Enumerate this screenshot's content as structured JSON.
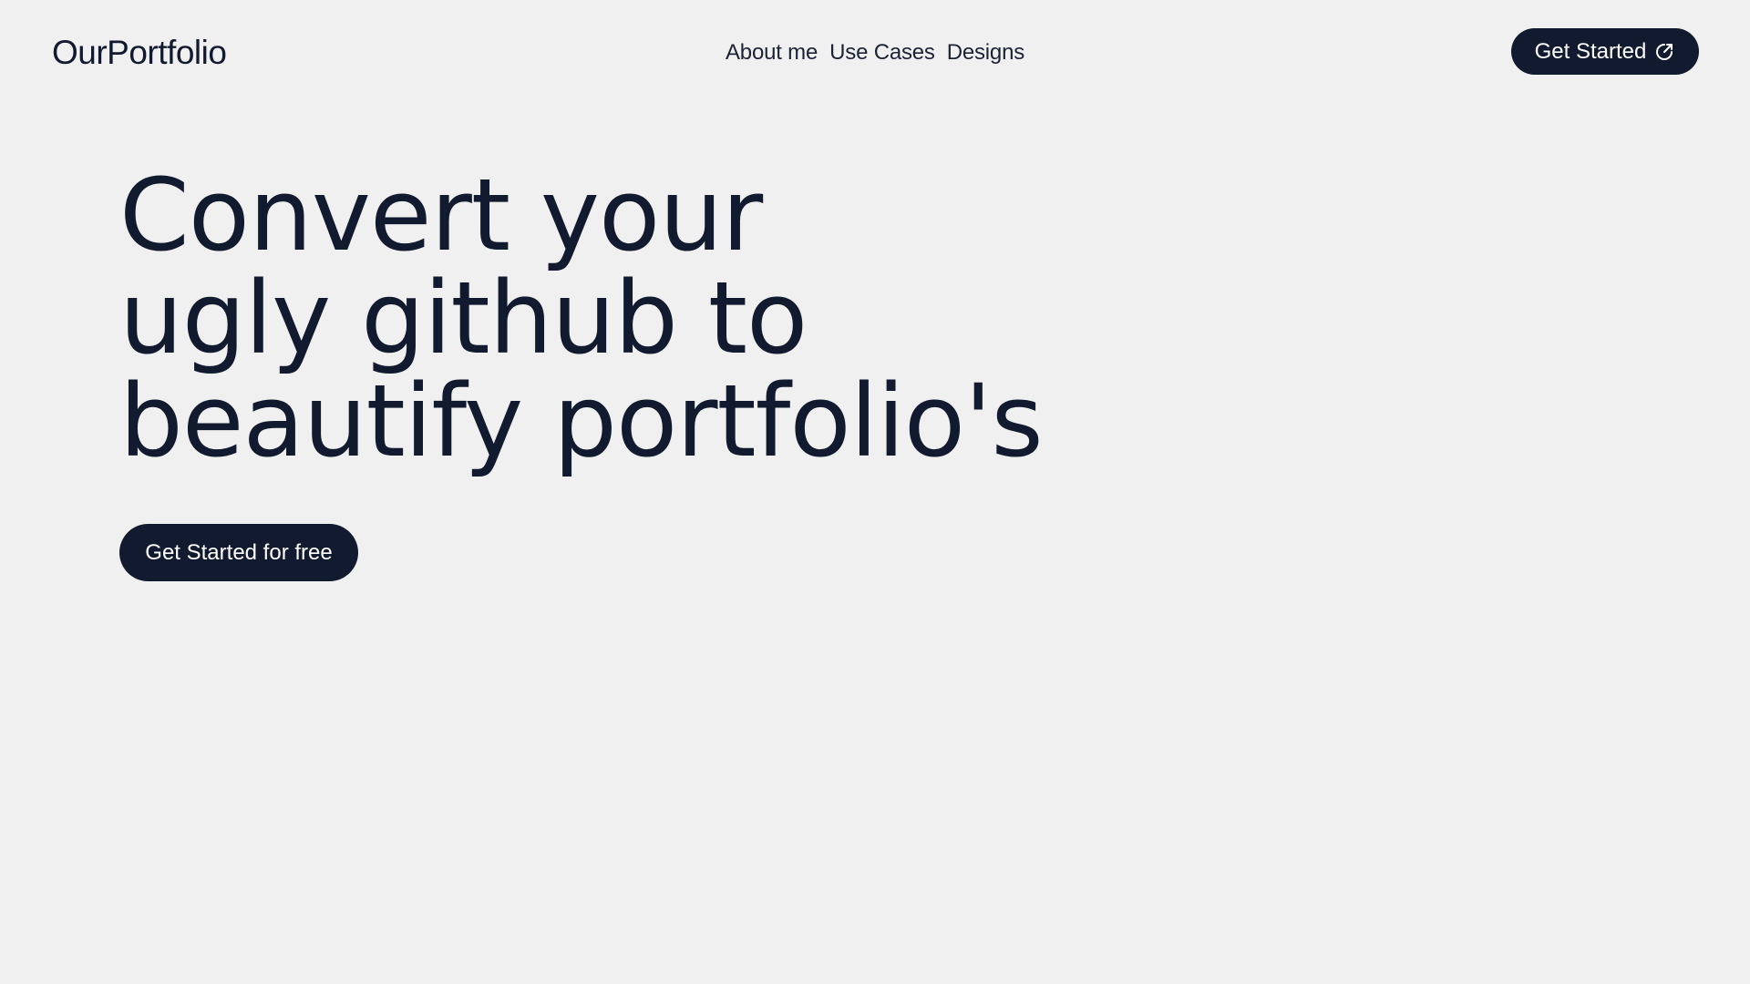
{
  "header": {
    "logo": "OurPortfolio",
    "nav": [
      {
        "label": "About me"
      },
      {
        "label": "Use Cases"
      },
      {
        "label": "Designs"
      }
    ],
    "cta_label": "Get Started",
    "cta_icon": "external-link-icon"
  },
  "hero": {
    "title_lines": [
      "Convert your",
      "ugly github to",
      "beautify portfolio's"
    ],
    "cta_label": "Get Started for free"
  },
  "colors": {
    "background": "#f0f0f0",
    "primary": "#111a2e",
    "button_text": "#ffffff"
  }
}
